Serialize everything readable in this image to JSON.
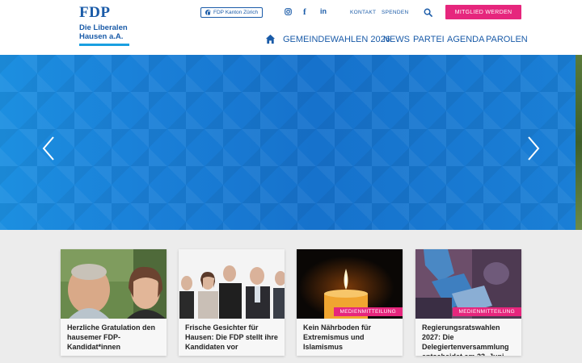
{
  "logo": {
    "name": "FDP",
    "line1": "Die Liberalen",
    "line2": "Hausen a.A."
  },
  "topbar": {
    "kanton_link": "FDP Kanton Zürich",
    "social": [
      "instagram-icon",
      "facebook-icon",
      "linkedin-icon"
    ],
    "social_glyphs": {
      "facebook": "f",
      "linkedin": "in"
    },
    "links": [
      "KONTAKT",
      "SPENDEN"
    ],
    "member_button": "MITGLIED WERDEN"
  },
  "nav": {
    "items": [
      "GEMEINDEWAHLEN 2026",
      "NEWS",
      "PARTEI",
      "AGENDA",
      "PAROLEN"
    ]
  },
  "colors": {
    "brand_blue": "#1a5ba8",
    "accent_pink": "#e6267d",
    "hero_blue": "#1877d1"
  },
  "cards": [
    {
      "title": "Herzliche Gratulation den hausemer FDP-Kandidat*innen",
      "badge": ""
    },
    {
      "title": "Frische Gesichter für Hausen: Die FDP stellt ihre Kandidaten vor",
      "badge": ""
    },
    {
      "title": "Kein Nährboden für Extremismus und Islamismus",
      "badge": "MEDIENMITTEILUNG"
    },
    {
      "title": "Regierungsratswahlen 2027: Die Delegiertenversammlung entscheidet am 23. Juni",
      "badge": "MEDIENMITTEILUNG"
    }
  ]
}
